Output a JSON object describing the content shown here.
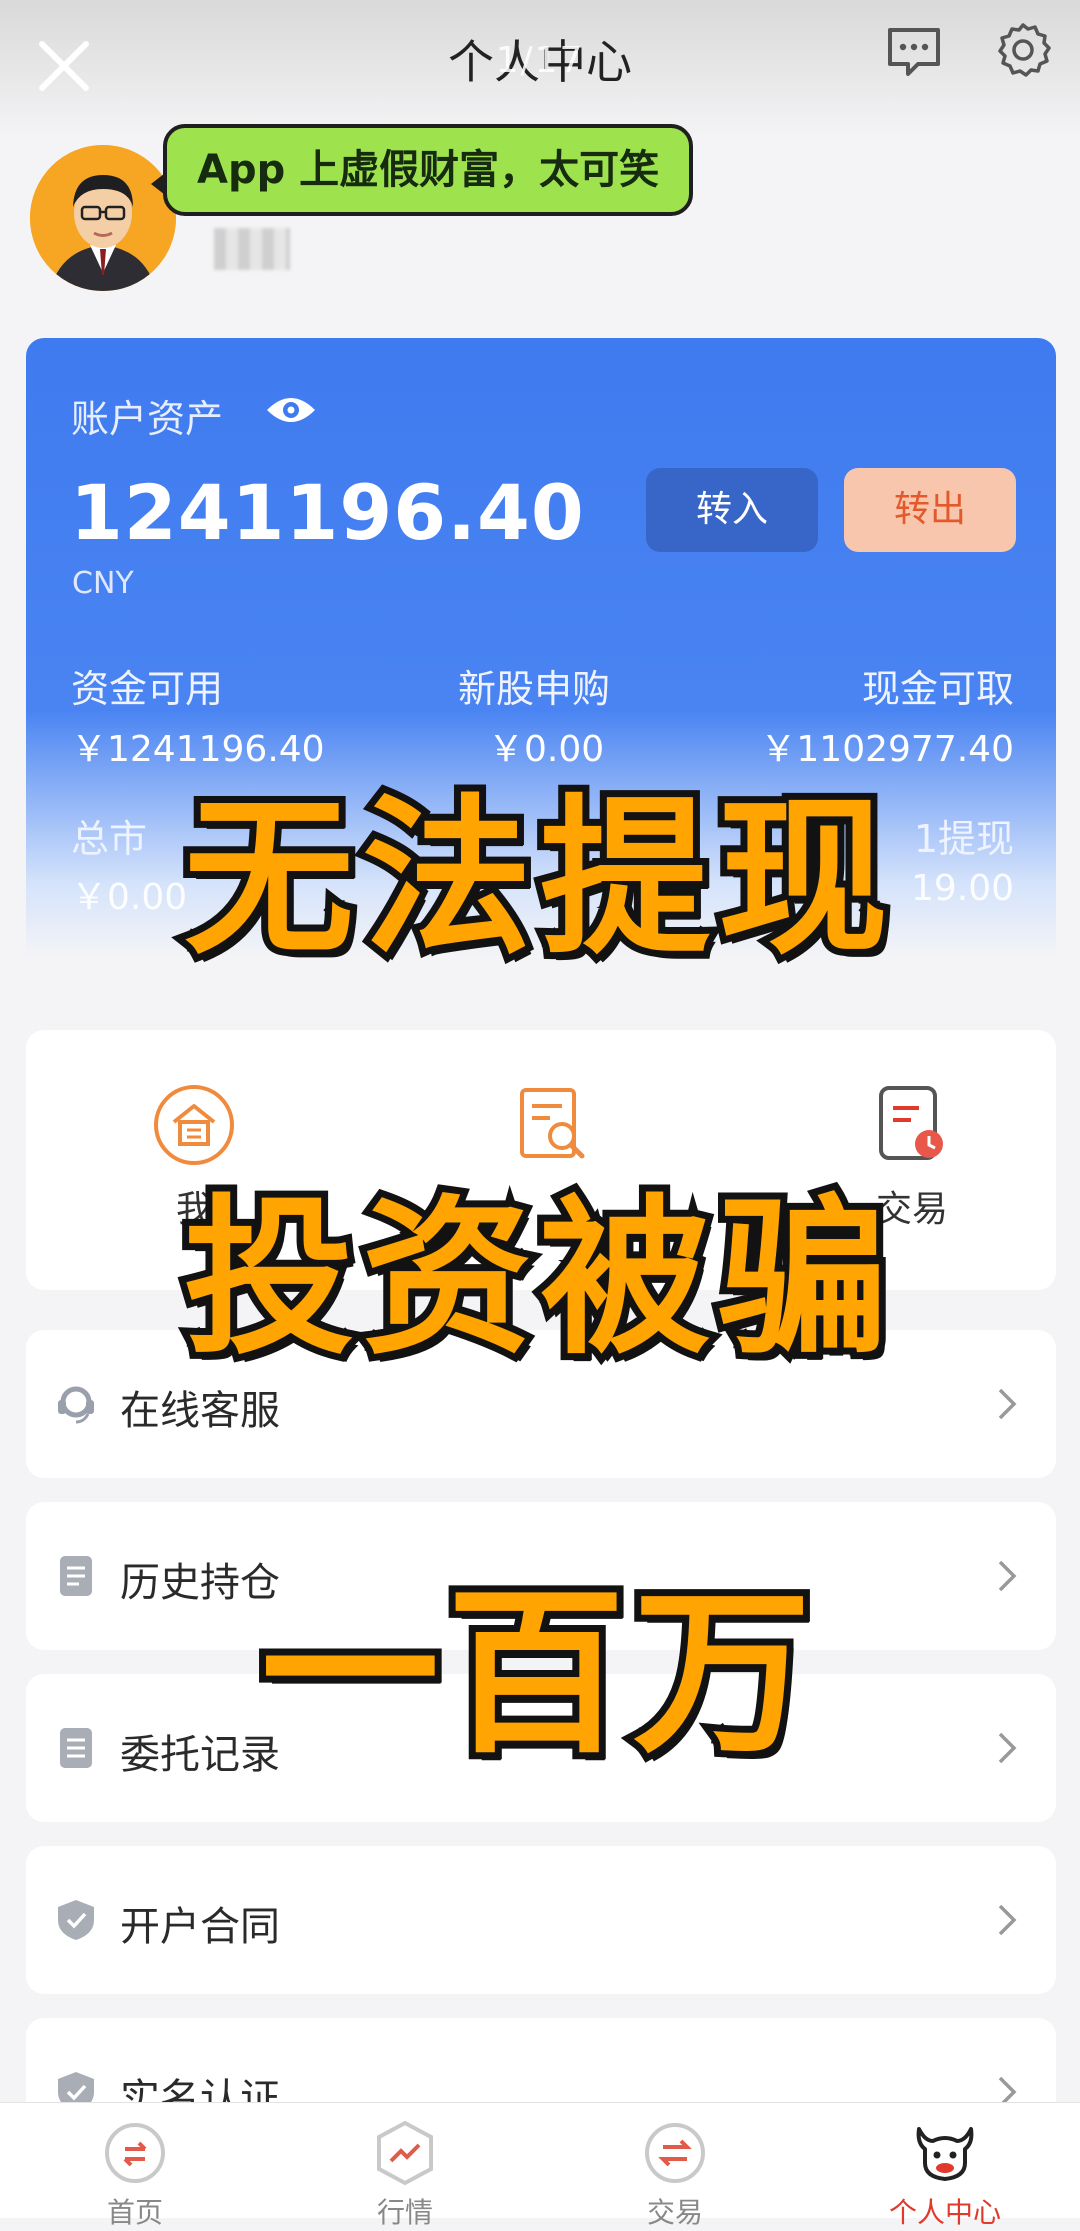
{
  "header": {
    "title": "个人中心",
    "counter": "1/17"
  },
  "profile": {
    "callout": "App 上虚假财富，太可笑"
  },
  "assets": {
    "label": "账户资产",
    "total": "1241196.40",
    "currency": "CNY",
    "btn_in": "转入",
    "btn_out": "转出",
    "stats": [
      {
        "label": "资金可用",
        "value": "￥1241196.40"
      },
      {
        "label": "新股申购",
        "value": "￥0.00"
      },
      {
        "label": "现金可取",
        "value": "￥1102977.40"
      }
    ],
    "stats_row2": [
      {
        "label": "总市",
        "value": "￥0.00"
      },
      {
        "label": "1提现",
        "value": "19.00"
      }
    ]
  },
  "quick": [
    {
      "label": "我",
      "icon": "bank-icon"
    },
    {
      "label": "",
      "icon": "search-doc-icon"
    },
    {
      "label": "交易",
      "icon": "clock-doc-icon"
    }
  ],
  "menu": [
    {
      "label": "在线客服",
      "icon": "headset-icon"
    },
    {
      "label": "历史持仓",
      "icon": "document-icon"
    },
    {
      "label": "委托记录",
      "icon": "list-icon"
    },
    {
      "label": "开户合同",
      "icon": "shield-icon"
    },
    {
      "label": "实名认证",
      "icon": "shield-check-icon"
    }
  ],
  "tabs": [
    {
      "label": "首页",
      "icon": "home-icon"
    },
    {
      "label": "行情",
      "icon": "market-icon"
    },
    {
      "label": "交易",
      "icon": "exchange-icon"
    },
    {
      "label": "个人中心",
      "icon": "bull-icon",
      "active": true
    }
  ],
  "overlay": {
    "line1": "无法提现",
    "line2": "投资被骗",
    "line3": "一百万"
  },
  "colors": {
    "accent": "#3f7bf0",
    "overlay": "#ffa400",
    "active_tab": "#e03a2a"
  }
}
